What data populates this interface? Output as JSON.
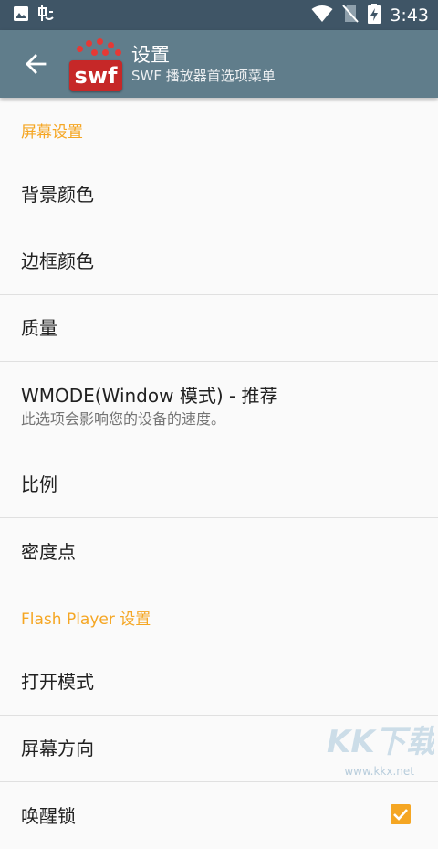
{
  "status_bar": {
    "time": "3:43",
    "icons": [
      "image-icon",
      "bug-icon",
      "wifi-icon",
      "no-sim-icon",
      "battery-charging-icon"
    ]
  },
  "toolbar": {
    "back_icon": "arrow-back-icon",
    "logo_text": "swf",
    "title": "设置",
    "subtitle": "SWF 播放器首选项菜单"
  },
  "sections": [
    {
      "header": "屏幕设置",
      "items": [
        {
          "title": "背景颜色",
          "summary": ""
        },
        {
          "title": "边框颜色",
          "summary": ""
        },
        {
          "title": "质量",
          "summary": ""
        },
        {
          "title": "WMODE(Window 模式) - 推荐",
          "summary": "此选项会影响您的设备的速度。"
        },
        {
          "title": "比例",
          "summary": ""
        },
        {
          "title": "密度点",
          "summary": ""
        }
      ]
    },
    {
      "header": "Flash Player 设置",
      "items": [
        {
          "title": "打开模式",
          "summary": ""
        },
        {
          "title": "屏幕方向",
          "summary": ""
        },
        {
          "title": "唤醒锁",
          "summary": "",
          "checked": true
        }
      ]
    }
  ],
  "watermark": {
    "text": "KK下载",
    "url": "www.kkx.net"
  },
  "colors": {
    "status_bar": "#3f5566",
    "toolbar": "#607d8b",
    "accent": "#f5a623",
    "logo": "#c62828"
  }
}
